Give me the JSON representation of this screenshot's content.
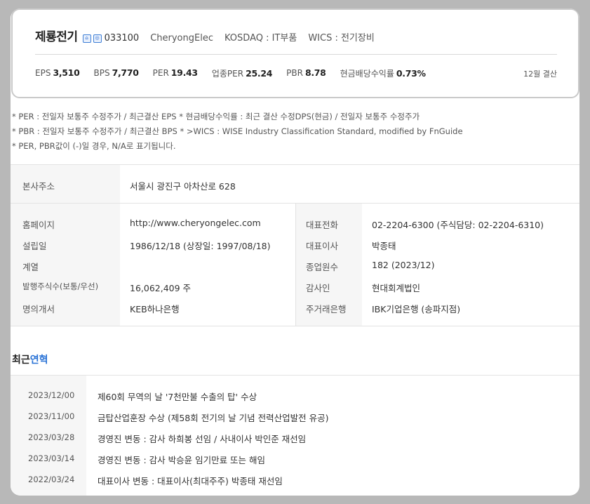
{
  "company": {
    "name": "제룡전기",
    "code": "033100",
    "english_name": "CheryongElec",
    "market": "KOSDAQ : IT부품",
    "wics": "WICS : 전기장비",
    "icons": [
      "home-icon",
      "ir-icon"
    ]
  },
  "metrics": [
    {
      "label": "EPS",
      "value": "3,510"
    },
    {
      "label": "BPS",
      "value": "7,770"
    },
    {
      "label": "PER",
      "value": "19.43"
    },
    {
      "label": "업종PER",
      "value": "25.24"
    },
    {
      "label": "PBR",
      "value": "8.78"
    },
    {
      "label": "현금배당수익률",
      "value": "0.73%"
    }
  ],
  "fiscal_note": "12월 결산",
  "notes": [
    "* PER : 전일자 보통주 수정주가 / 최근결산 EPS * 현금배당수익률 : 최근 결산 수정DPS(현금) / 전일자 보통주 수정주가",
    "* PBR : 전일자 보통주 수정주가 / 최근결산 BPS * >WICS : WISE Industry Classification Standard, modified by FnGuide",
    "* PER, PBR값이 (-)일 경우, N/A로 표기됩니다."
  ],
  "address": {
    "label": "본사주소",
    "value": "서울시 광진구 아차산로 628"
  },
  "info_left": [
    {
      "label": "홈페이지",
      "value": "http://www.cheryongelec.com"
    },
    {
      "label": "설립일",
      "value": "1986/12/18 (상장일: 1997/08/18)"
    },
    {
      "label": "계열",
      "value": ""
    },
    {
      "label": "발행주식수(보통/우선)",
      "value": "16,062,409 주"
    },
    {
      "label": "명의개서",
      "value": "KEB하나은행"
    }
  ],
  "info_right": [
    {
      "label": "대표전화",
      "value": "02-2204-6300 (주식담당: 02-2204-6310)"
    },
    {
      "label": "대표이사",
      "value": "박종태"
    },
    {
      "label": "종업원수",
      "value": "182 (2023/12)"
    },
    {
      "label": "감사인",
      "value": "현대회계법인"
    },
    {
      "label": "주거래은행",
      "value": "IBK기업은행 (송파지점)"
    }
  ],
  "history_title": {
    "prefix": "최근",
    "accent": "연혁"
  },
  "history": [
    {
      "date": "2023/12/00",
      "text": "제60회 무역의 날 '7천만불 수출의 탑' 수상"
    },
    {
      "date": "2023/11/00",
      "text": "금탑산업훈장 수상 (제58회 전기의 날 기념 전력산업발전 유공)"
    },
    {
      "date": "2023/03/28",
      "text": "경영진 변동 : 감사 하희봉 선임 / 사내이사 박인준 재선임"
    },
    {
      "date": "2023/03/14",
      "text": "경영진 변동 : 감사 박승윤 임기만료 또는 해임"
    },
    {
      "date": "2022/03/24",
      "text": "대표이사 변동 : 대표이사(최대주주) 박종태 재선임"
    }
  ]
}
